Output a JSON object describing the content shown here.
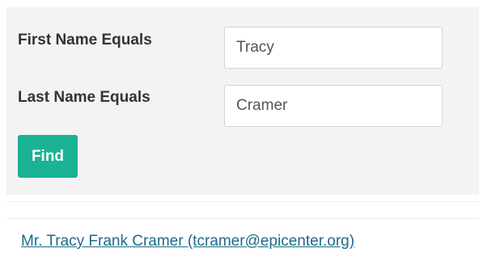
{
  "search_form": {
    "first_name_label": "First Name Equals",
    "first_name_value": "Tracy",
    "last_name_label": "Last Name Equals",
    "last_name_value": "Cramer",
    "find_label": "Find"
  },
  "results": {
    "items": [
      {
        "text": "Mr. Tracy Frank Cramer (tcramer@epicenter.org)"
      }
    ]
  },
  "colors": {
    "panel_background": "#f3f3f4",
    "button_accent": "#1ab394",
    "link": "#1c6b8a"
  }
}
